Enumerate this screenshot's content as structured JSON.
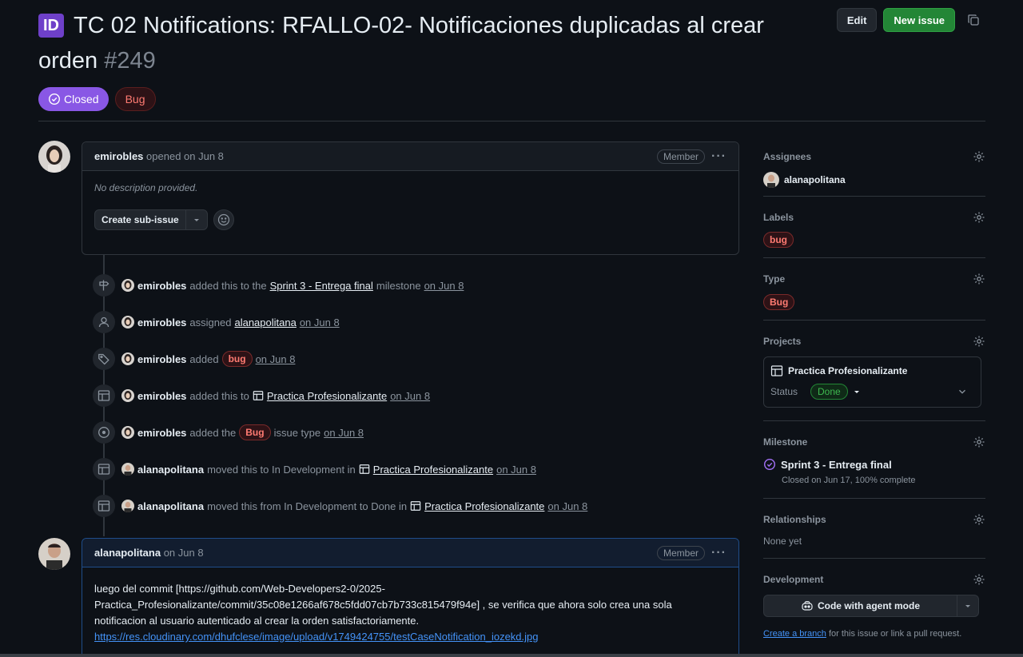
{
  "issue": {
    "type_badge": "ID",
    "title": "TC 02 Notifications: RFALLO-02- Notificaciones duplicadas al crear orden",
    "number": "#249",
    "state": "Closed",
    "type_label": "Bug"
  },
  "header_actions": {
    "edit": "Edit",
    "new_issue": "New issue"
  },
  "opening_comment": {
    "author": "emirobles",
    "meta": "opened on Jun 8",
    "role": "Member",
    "body": "No description provided.",
    "sub_issue_button": "Create sub-issue"
  },
  "events": [
    {
      "icon": "milestone-icon",
      "actor": "emirobles",
      "parts": [
        "added this to the"
      ],
      "link": "Sprint 3 - Entrega final",
      "after": "milestone",
      "date": "on Jun 8"
    },
    {
      "icon": "person-icon",
      "actor": "emirobles",
      "parts": [
        "assigned"
      ],
      "link": "alanapolitana",
      "after": "",
      "date": "on Jun 8"
    },
    {
      "icon": "tag-icon",
      "actor": "emirobles",
      "parts": [
        "added"
      ],
      "label": "bug",
      "date": "on Jun 8"
    },
    {
      "icon": "table-icon",
      "actor": "emirobles",
      "parts": [
        "added this to"
      ],
      "link": "Practica Profesionalizante",
      "date": "on Jun 8"
    },
    {
      "icon": "issue-type-icon",
      "actor": "emirobles",
      "parts": [
        "added the"
      ],
      "label": "Bug",
      "after": "issue type",
      "date": "on Jun 8"
    },
    {
      "icon": "table-icon",
      "actor": "alanapolitana",
      "parts": [
        "moved this to In Development in"
      ],
      "link": "Practica Profesionalizante",
      "date": "on Jun 8"
    },
    {
      "icon": "table-icon",
      "actor": "alanapolitana",
      "parts": [
        "moved this from In Development to Done in"
      ],
      "link": "Practica Profesionalizante",
      "date": "on Jun 8"
    }
  ],
  "second_comment": {
    "author": "alanapolitana",
    "meta": "on Jun 8",
    "role": "Member",
    "body_line1": "luego del commit [https://github.com/Web-Developers2-0/2025-",
    "body_line2": "Practica_Profesionalizante/commit/35c08e1266af678c5fdd07cb7b733c815479f94e] , se verifica que ahora solo crea una sola",
    "body_line3": "notificacion al usuario autenticado al crear la orden satisfactoriamente.",
    "link": "https://res.cloudinary.com/dhufclese/image/upload/v1749424755/testCaseNotification_iozekd.jpg"
  },
  "sidebar": {
    "assignees": {
      "title": "Assignees",
      "value": "alanapolitana"
    },
    "labels": {
      "title": "Labels",
      "value": "bug"
    },
    "type": {
      "title": "Type",
      "value": "Bug"
    },
    "projects": {
      "title": "Projects",
      "name": "Practica Profesionalizante",
      "status_label": "Status",
      "status_value": "Done"
    },
    "milestone": {
      "title": "Milestone",
      "name": "Sprint 3 - Entrega final",
      "meta": "Closed on Jun 17, 100% complete"
    },
    "relationships": {
      "title": "Relationships",
      "value": "None yet"
    },
    "development": {
      "title": "Development",
      "button": "Code with agent mode",
      "link": "Create a branch",
      "rest": "for this issue or link a pull request."
    }
  },
  "colors": {
    "closed": "#8957e5",
    "green": "#238636",
    "bug": "#ff7b72",
    "link": "#4493f8"
  }
}
